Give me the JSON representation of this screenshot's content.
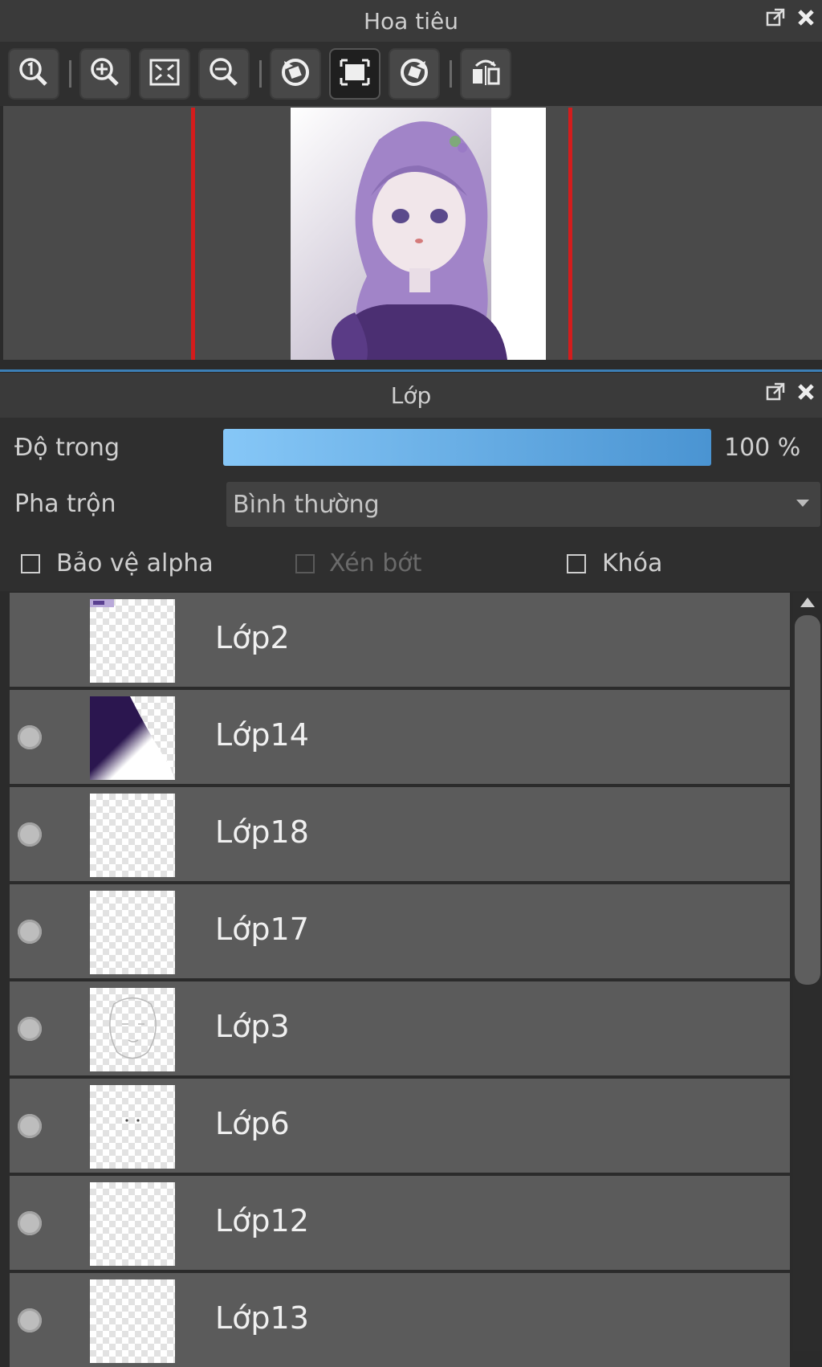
{
  "navigator": {
    "title": "Hoa tiêu",
    "toolbar": [
      {
        "name": "zoom-actual-button",
        "icon": "zoom-100-icon"
      },
      {
        "name": "zoom-in-button",
        "icon": "zoom-in-icon"
      },
      {
        "name": "fit-screen-button",
        "icon": "fit-screen-icon"
      },
      {
        "name": "zoom-out-button",
        "icon": "zoom-out-icon"
      },
      {
        "name": "rotate-left-button",
        "icon": "rotate-left-icon"
      },
      {
        "name": "reset-view-button",
        "icon": "reset-view-icon"
      },
      {
        "name": "rotate-right-button",
        "icon": "rotate-right-icon"
      },
      {
        "name": "flip-horizontal-button",
        "icon": "flip-horizontal-icon"
      }
    ]
  },
  "layers_panel": {
    "title": "Lớp",
    "opacity_label": "Độ trong",
    "opacity_value": "100 %",
    "opacity_fraction": 1.0,
    "blend_label": "Pha trộn",
    "blend_value": "Bình thường",
    "protect_alpha_label": "Bảo vệ alpha",
    "clipping_label": "Xén bớt",
    "lock_label": "Khóa",
    "layers": [
      {
        "name": "Lớp2",
        "visible_dot": false
      },
      {
        "name": "Lớp14",
        "visible_dot": true
      },
      {
        "name": "Lớp18",
        "visible_dot": true
      },
      {
        "name": "Lớp17",
        "visible_dot": true
      },
      {
        "name": "Lớp3",
        "visible_dot": true
      },
      {
        "name": "Lớp6",
        "visible_dot": true
      },
      {
        "name": "Lớp12",
        "visible_dot": true
      },
      {
        "name": "Lớp13",
        "visible_dot": true
      }
    ]
  },
  "colors": {
    "accent": "#3c7fb6",
    "frame_line": "#d41c1c",
    "opacity_start": "#86c7f7",
    "opacity_end": "#4a94d2"
  }
}
